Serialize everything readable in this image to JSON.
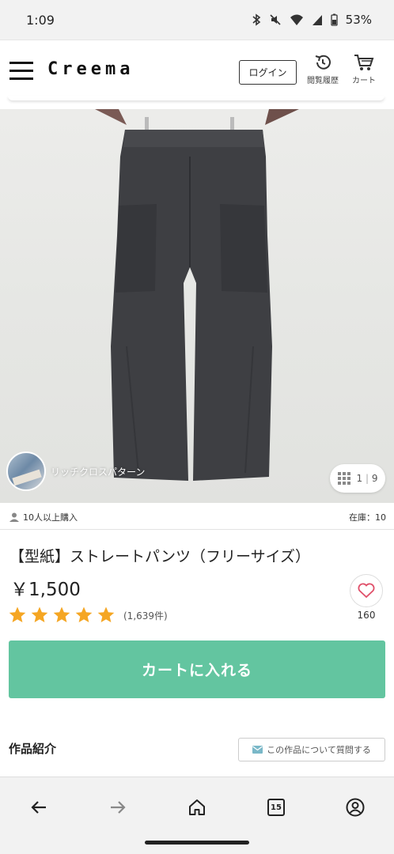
{
  "status_bar": {
    "time": "1:09",
    "battery": "53%"
  },
  "header": {
    "logo": "Creema",
    "login_label": "ログイン",
    "history_label": "閲覧履歴",
    "cart_label": "カート"
  },
  "gallery": {
    "shop_name": "リッチクロスパターン",
    "counter_current": "1",
    "counter_sep": "|",
    "counter_total": "9"
  },
  "meta": {
    "buyers": "10人以上購入",
    "stock": "在庫：10"
  },
  "product": {
    "title": "【型紙】ストレートパンツ（フリーサイズ）",
    "price": "￥1,500",
    "rating_stars": 5,
    "review_count": "(1,639件)",
    "favorites": "160",
    "star_color": "#f5a623",
    "heart_color": "#e0506a"
  },
  "actions": {
    "add_to_cart": "カートに入れる",
    "cart_color": "#63c5a0"
  },
  "details": {
    "intro_label": "作品紹介",
    "question_label": "この作品について質問する"
  },
  "browser_nav": {
    "tab_count": "15"
  }
}
